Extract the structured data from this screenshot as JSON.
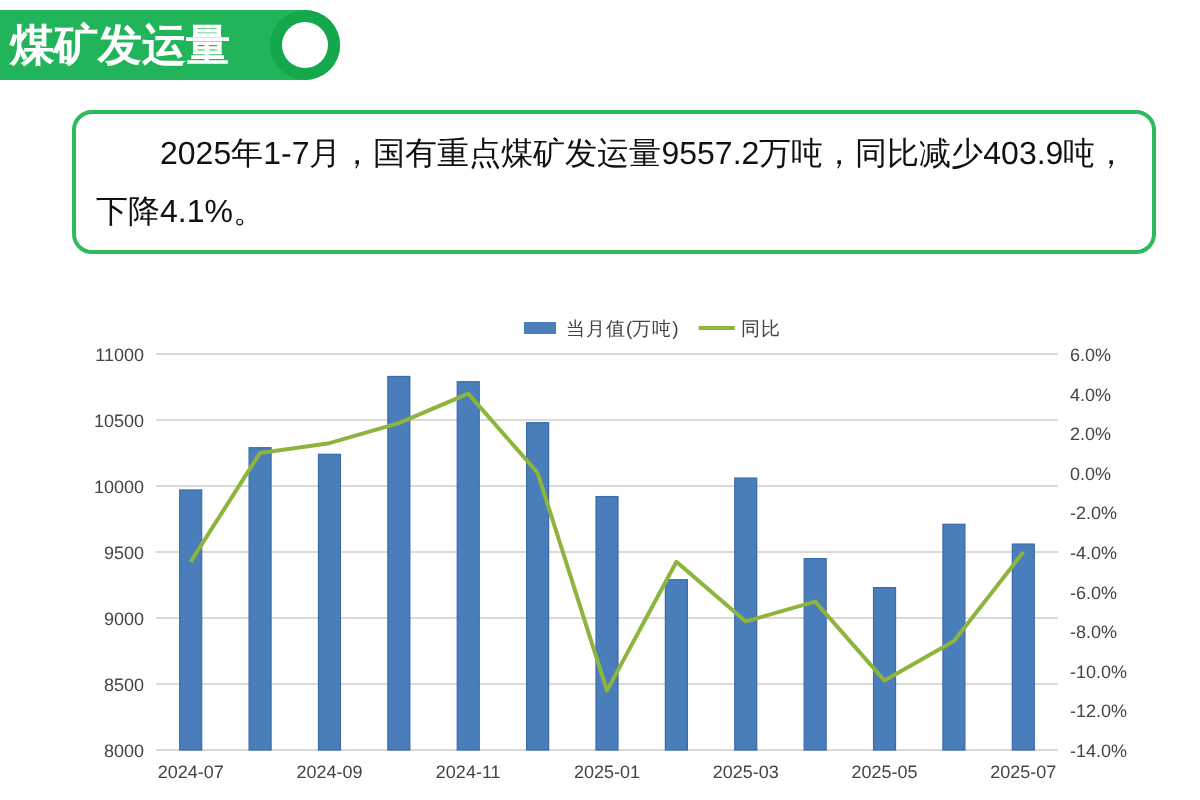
{
  "header": {
    "title": "煤矿发运量"
  },
  "summary": {
    "text": "2025年1-7月，国有重点煤矿发运量9557.2万吨，同比减少403.9吨，下降4.1%。"
  },
  "chart": {
    "chart_data": {
      "type": "bar",
      "grid": true,
      "legend": "top",
      "categories": [
        "2024-07",
        null,
        "2024-09",
        null,
        "2024-11",
        null,
        "2025-01",
        null,
        "2025-03",
        null,
        "2025-05",
        null,
        "2025-07"
      ],
      "ylim": [
        8000,
        11000
      ],
      "yticks": [
        {
          "value": 8000,
          "label": "8000"
        },
        {
          "value": 8500,
          "label": "8500"
        },
        {
          "value": 9000,
          "label": "9000"
        },
        {
          "value": 9500,
          "label": "9500"
        },
        {
          "value": 10000,
          "label": "10000"
        },
        {
          "value": 10500,
          "label": "10500"
        },
        {
          "value": 11000,
          "label": "11000"
        }
      ],
      "y2lim": [
        -14,
        6
      ],
      "y2ticks": [
        {
          "value": 6,
          "label": "6.0%"
        },
        {
          "value": 4,
          "label": "4.0%"
        },
        {
          "value": 2,
          "label": "2.0%"
        },
        {
          "value": 0,
          "label": "0.0%"
        },
        {
          "value": -2,
          "label": "-2.0%"
        },
        {
          "value": -4,
          "label": "-4.0%"
        },
        {
          "value": -6,
          "label": "-6.0%"
        },
        {
          "value": -8,
          "label": "-8.0%"
        },
        {
          "value": -10,
          "label": "-10.0%"
        },
        {
          "value": -12,
          "label": "-12.0%"
        },
        {
          "value": -14,
          "label": "-14.0%"
        }
      ],
      "series": [
        {
          "name": "当月值(万吨)",
          "color": "#4a7ebb",
          "values": [
            9970,
            10290,
            10240,
            10830,
            10790,
            10480,
            9920,
            9290,
            10060,
            9450,
            9230,
            9710,
            9560
          ]
        },
        {
          "name": "同比",
          "type": "line",
          "axis": "y2",
          "color": "#8db43c",
          "values": [
            -4.5,
            1,
            1.5,
            2.5,
            4,
            0,
            -11,
            -4.5,
            -7.5,
            -6.5,
            -10.5,
            -8.5,
            -4
          ]
        }
      ]
    }
  }
}
